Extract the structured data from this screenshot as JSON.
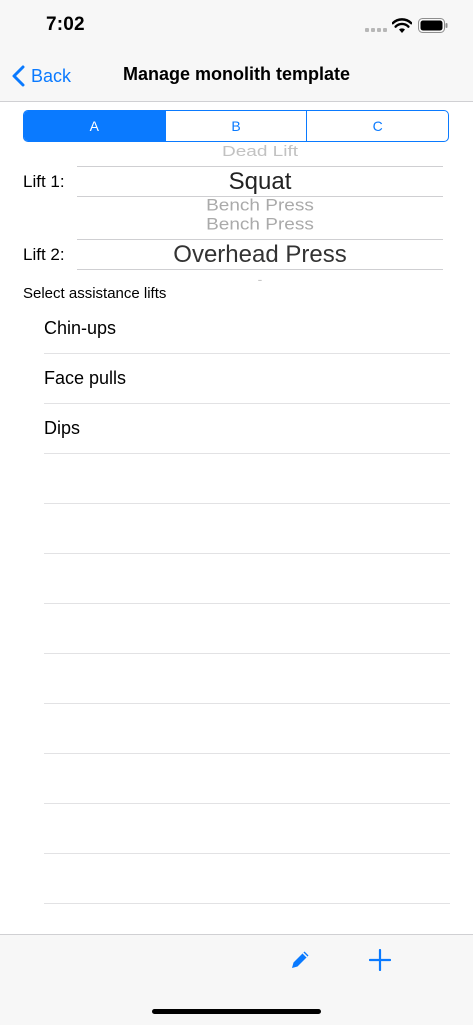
{
  "status": {
    "time": "7:02"
  },
  "nav": {
    "back_label": "Back",
    "title": "Manage monolith template"
  },
  "tabs": [
    {
      "label": "A",
      "selected": true
    },
    {
      "label": "B",
      "selected": false
    },
    {
      "label": "C",
      "selected": false
    }
  ],
  "lift1": {
    "label": "Lift 1:",
    "above": "Dead Lift",
    "selected": "Squat",
    "below": "Bench Press"
  },
  "lift2": {
    "label": "Lift 2:",
    "above": "Bench Press",
    "selected": "Overhead Press",
    "below": "-"
  },
  "assistance": {
    "header": "Select assistance lifts",
    "items": [
      "Chin-ups",
      "Face pulls",
      "Dips",
      "",
      "",
      "",
      "",
      "",
      "",
      "",
      "",
      "",
      ""
    ]
  },
  "colors": {
    "accent": "#0a7aff"
  },
  "toolbar": {
    "edit_icon": "pencil-icon",
    "add_icon": "plus-icon"
  }
}
